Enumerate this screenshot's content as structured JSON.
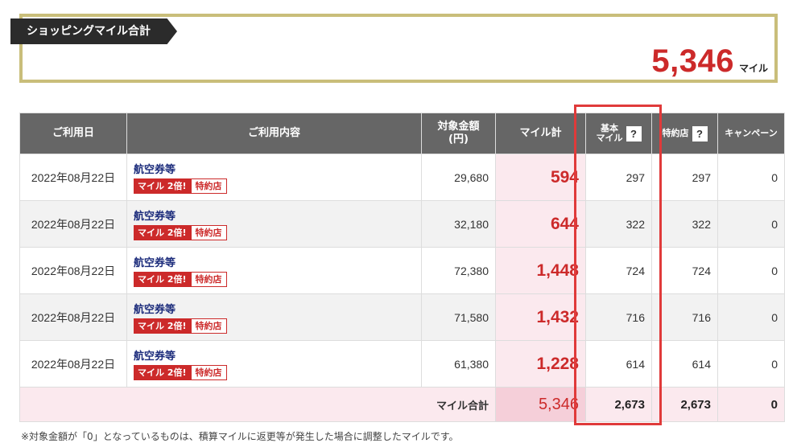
{
  "summary": {
    "label": "ショッピングマイル合計",
    "total": "5,346",
    "unit": "マイル"
  },
  "table": {
    "headers": {
      "date": "ご利用日",
      "content": "ご利用内容",
      "amount_line1": "対象金額",
      "amount_line2": "(円)",
      "miles": "マイル計",
      "base_line1": "基本",
      "base_line2": "マイル",
      "partner": "特約店",
      "campaign": "キャンペーン",
      "help": "?"
    },
    "rows": [
      {
        "date": "2022年08月22日",
        "item": "航空券等",
        "badge1": "マイル 2倍!",
        "badge2": "特約店",
        "amount": "29,680",
        "miles": "594",
        "base": "297",
        "partner": "297",
        "campaign": "0"
      },
      {
        "date": "2022年08月22日",
        "item": "航空券等",
        "badge1": "マイル 2倍!",
        "badge2": "特約店",
        "amount": "32,180",
        "miles": "644",
        "base": "322",
        "partner": "322",
        "campaign": "0"
      },
      {
        "date": "2022年08月22日",
        "item": "航空券等",
        "badge1": "マイル 2倍!",
        "badge2": "特約店",
        "amount": "72,380",
        "miles": "1,448",
        "base": "724",
        "partner": "724",
        "campaign": "0"
      },
      {
        "date": "2022年08月22日",
        "item": "航空券等",
        "badge1": "マイル 2倍!",
        "badge2": "特約店",
        "amount": "71,580",
        "miles": "1,432",
        "base": "716",
        "partner": "716",
        "campaign": "0"
      },
      {
        "date": "2022年08月22日",
        "item": "航空券等",
        "badge1": "マイル 2倍!",
        "badge2": "特約店",
        "amount": "61,380",
        "miles": "1,228",
        "base": "614",
        "partner": "614",
        "campaign": "0"
      }
    ],
    "footer": {
      "label": "マイル合計",
      "miles": "5,346",
      "base": "2,673",
      "partner": "2,673",
      "campaign": "0"
    }
  },
  "note": "※対象金額が「0」となっているものは、積算マイルに返更等が発生した場合に調整したマイルです。",
  "colors": {
    "accent": "#cc2a2a",
    "gold_border": "#c9be7a",
    "header_bg": "#666666",
    "highlight": "#e03a3a"
  }
}
